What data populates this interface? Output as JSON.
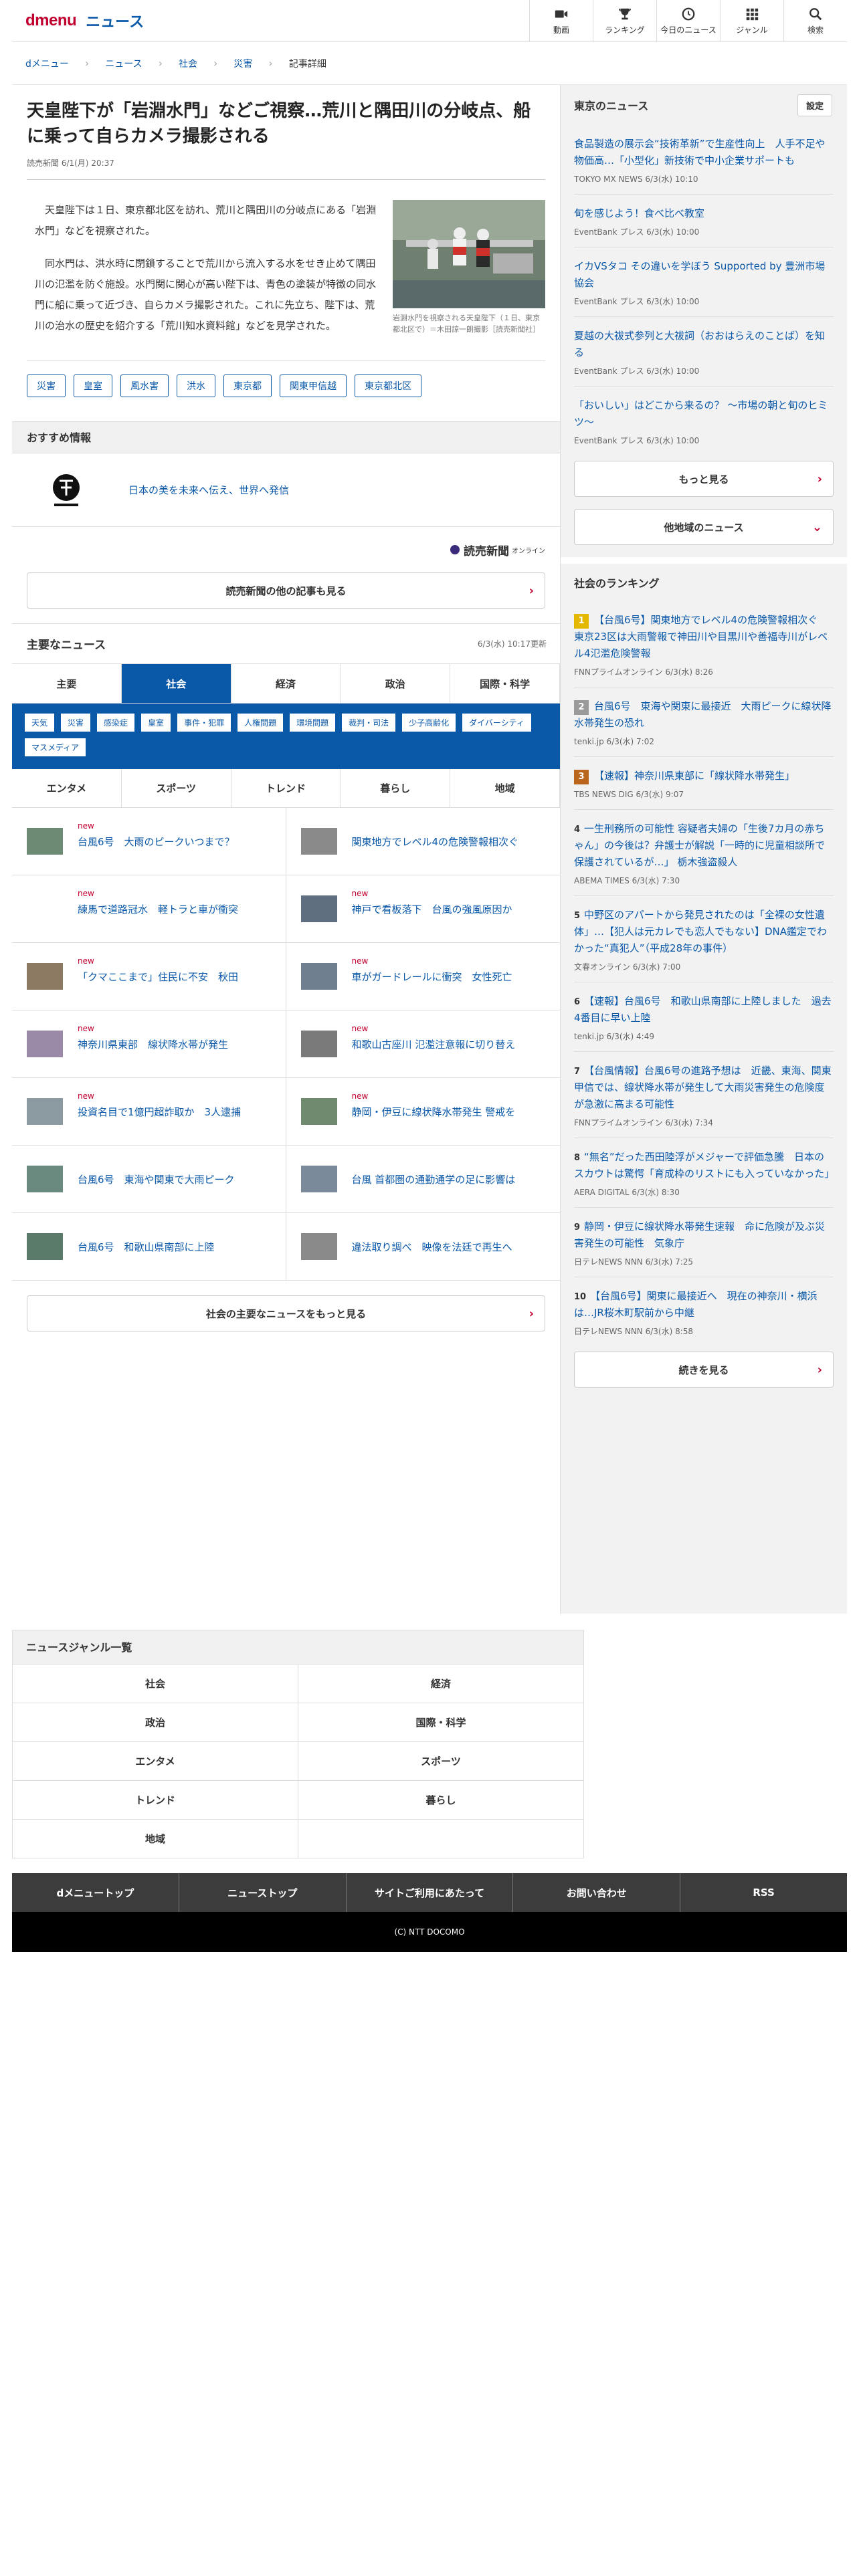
{
  "header": {
    "logo_d": "dmenu",
    "logo_news": "ニュース",
    "nav": [
      {
        "label": "動画",
        "icon": "video-icon"
      },
      {
        "label": "ランキング",
        "icon": "trophy-icon"
      },
      {
        "label": "今日のニュース",
        "icon": "clock-icon"
      },
      {
        "label": "ジャンル",
        "icon": "grid-icon"
      },
      {
        "label": "検索",
        "icon": "search-icon"
      }
    ]
  },
  "breadcrumb": [
    "dメニュー",
    "ニュース",
    "社会",
    "災害",
    "記事詳細"
  ],
  "article": {
    "title": "天皇陛下が「岩淵水門」などご視察…荒川と隅田川の分岐点、船に乗って自らカメラ撮影される",
    "source": "読売新聞 6/1(月) 20:37",
    "p1": "天皇陛下は１日、東京都北区を訪れ、荒川と隅田川の分岐点にある「岩淵水門」などを視察された。",
    "p2": "同水門は、洪水時に閉鎖することで荒川から流入する水をせき止めて隅田川の氾濫を防ぐ施設。水門関に関心が高い陛下は、青色の塗装が特徴の同水門に船に乗って近づき、自らカメラ撮影された。これに先立ち、陛下は、荒川の治水の歴史を紹介する「荒川知水資料館」などを見学された。",
    "caption": "岩淵水門を視察される天皇陛下（１日、東京都北区で）＝木田諒一朗撮影［読売新聞社］",
    "tags": [
      "災害",
      "皇室",
      "風水害",
      "洪水",
      "東京都",
      "関東甲信越",
      "東京都北区"
    ]
  },
  "recommend": {
    "heading": "おすすめ情報",
    "text": "日本の美を未来へ伝え、世界へ発信",
    "yomiuri": "読売新聞",
    "yomiuri_sub": "オンライン",
    "more_btn": "読売新聞の他の記事も見る"
  },
  "main_news": {
    "heading": "主要なニュース",
    "updated": "6/3(水) 10:17更新",
    "tabs": [
      "主要",
      "社会",
      "経済",
      "政治",
      "国際・科学"
    ],
    "sub_tags": [
      "天気",
      "災害",
      "感染症",
      "皇室",
      "事件・犯罪",
      "人権問題",
      "環境問題",
      "裁判・司法",
      "少子高齢化",
      "ダイバーシティ",
      "マスメディア"
    ],
    "tabs2": [
      "エンタメ",
      "スポーツ",
      "トレンド",
      "暮らし",
      "地域"
    ],
    "new_label": "new",
    "items": [
      {
        "title": "台風6号　大雨のピークいつまで？",
        "new": true,
        "thumb": true
      },
      {
        "title": "関東地方でレベル4の危険警報相次ぐ",
        "new": false,
        "thumb": true
      },
      {
        "title": "練馬で道路冠水　軽トラと車が衝突",
        "new": true,
        "thumb": false
      },
      {
        "title": "神戸で看板落下　台風の強風原因か",
        "new": true,
        "thumb": true
      },
      {
        "title": "「クマここまで」住民に不安　秋田",
        "new": true,
        "thumb": true
      },
      {
        "title": "車がガードレールに衝突　女性死亡",
        "new": true,
        "thumb": true
      },
      {
        "title": "神奈川県東部　線状降水帯が発生",
        "new": true,
        "thumb": true
      },
      {
        "title": "和歌山古座川 氾濫注意報に切り替え",
        "new": true,
        "thumb": true
      },
      {
        "title": "投資名目で1億円超詐取か　3人逮捕",
        "new": true,
        "thumb": true
      },
      {
        "title": "静岡・伊豆に線状降水帯発生 警戒を",
        "new": true,
        "thumb": true
      },
      {
        "title": "台風6号　東海や関東で大雨ピーク",
        "new": false,
        "thumb": true
      },
      {
        "title": "台風 首都圏の通勤通学の足に影響は",
        "new": false,
        "thumb": true
      },
      {
        "title": "台風6号　和歌山県南部に上陸",
        "new": false,
        "thumb": true
      },
      {
        "title": "違法取り調べ　映像を法廷で再生へ",
        "new": false,
        "thumb": true
      }
    ],
    "more_btn": "社会の主要なニュースをもっと見る"
  },
  "tokyo": {
    "heading": "東京のニュース",
    "setting": "設定",
    "items": [
      {
        "title": "食品製造の展示会“技術革新”で生産性向上　人手不足や物価高…「小型化」新技術で中小企業サポートも",
        "meta": "TOKYO MX NEWS 6/3(水) 10:10"
      },
      {
        "title": "旬を感じよう！食べ比べ教室",
        "meta": "EventBank プレス 6/3(水) 10:00"
      },
      {
        "title": "イカVSタコ その違いを学ぼう Supported by 豊洲市場協会",
        "meta": "EventBank プレス 6/3(水) 10:00"
      },
      {
        "title": "夏越の大祓式参列と大祓詞（おおはらえのことば）を知る",
        "meta": "EventBank プレス 6/3(水) 10:00"
      },
      {
        "title": "「おいしい」はどこから来るの？ 〜市場の朝と旬のヒミツ〜",
        "meta": "EventBank プレス 6/3(水) 10:00"
      }
    ],
    "more": "もっと見る",
    "other": "他地域のニュース"
  },
  "ranking": {
    "heading": "社会のランキング",
    "items": [
      {
        "n": "1",
        "title": "【台風6号】関東地方でレベル4の危険警報相次ぐ　東京23区は大雨警報で神田川や目黒川や善福寺川がレベル4氾濫危険警報",
        "meta": "FNNプライムオンライン 6/3(水) 8:26"
      },
      {
        "n": "2",
        "title": "台風6号　東海や関東に最接近　大雨ピークに線状降水帯発生の恐れ",
        "meta": "tenki.jp 6/3(水) 7:02"
      },
      {
        "n": "3",
        "title": "【速報】神奈川県東部に「線状降水帯発生」",
        "meta": "TBS NEWS DIG 6/3(水) 9:07"
      },
      {
        "n": "4",
        "title": "一生刑務所の可能性 容疑者夫婦の「生後7カ月の赤ちゃん」の今後は？弁護士が解説「一時的に児童相談所で保護されているが…」 栃木強盗殺人",
        "meta": "ABEMA TIMES 6/3(水) 7:30"
      },
      {
        "n": "5",
        "title": "中野区のアパートから発見されたのは「全裸の女性遺体」…【犯人は元カレでも恋人でもない】DNA鑑定でわかった“真犯人”（平成28年の事件）",
        "meta": "文春オンライン 6/3(水) 7:00"
      },
      {
        "n": "6",
        "title": "【速報】台風6号　和歌山県南部に上陸しました　過去4番目に早い上陸",
        "meta": "tenki.jp 6/3(水) 4:49"
      },
      {
        "n": "7",
        "title": "【台風情報】台風6号の進路予想は　近畿、東海、関東甲信では、線状降水帯が発生して大雨災害発生の危険度が急激に高まる可能性",
        "meta": "FNNプライムオンライン 6/3(水) 7:34"
      },
      {
        "n": "8",
        "title": "“無名”だった西田陸浮がメジャーで評価急騰　日本のスカウトは驚愕「育成枠のリストにも入っていなかった」",
        "meta": "AERA DIGITAL 6/3(水) 8:30"
      },
      {
        "n": "9",
        "title": "静岡・伊豆に線状降水帯発生速報　命に危険が及ぶ災害発生の可能性　気象庁",
        "meta": "日テレNEWS NNN 6/3(水) 7:25"
      },
      {
        "n": "10",
        "title": "【台風6号】関東に最接近へ　現在の神奈川・横浜は…JR桜木町駅前から中継",
        "meta": "日テレNEWS NNN 6/3(水) 8:58"
      }
    ],
    "more": "続きを見る"
  },
  "genre": {
    "heading": "ニュースジャンル一覧",
    "items": [
      "社会",
      "経済",
      "政治",
      "国際・科学",
      "エンタメ",
      "スポーツ",
      "トレンド",
      "暮らし",
      "地域",
      ""
    ]
  },
  "footer": {
    "nav": [
      "dメニュートップ",
      "ニューストップ",
      "サイトご利用にあたって",
      "お問い合わせ",
      "RSS"
    ],
    "copyright": "(C) NTT DOCOMO"
  },
  "colors": {
    "brand_red": "#c2002f",
    "link_blue": "#0a58a8"
  }
}
